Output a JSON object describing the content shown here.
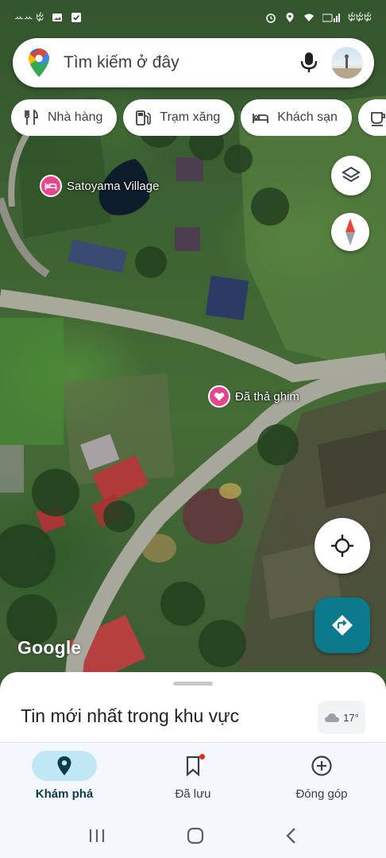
{
  "status_bar": {
    "left_text": "ꕀꕀ ꔲ",
    "right_text": "ꔲꔲꔲ"
  },
  "search": {
    "placeholder": "Tìm kiếm ở đây"
  },
  "chips": [
    {
      "label": "Nhà hàng",
      "icon": "restaurant-icon"
    },
    {
      "label": "Trạm xăng",
      "icon": "gas-station-icon"
    },
    {
      "label": "Khách sạn",
      "icon": "hotel-icon"
    },
    {
      "label": "",
      "icon": "coffee-icon"
    }
  ],
  "map": {
    "places": [
      {
        "label": "Satoyama Village",
        "icon": "hotel-icon",
        "color": "#e8468c"
      },
      {
        "label": "Đã thả ghim",
        "icon": "heart-icon",
        "color": "#e8468c"
      }
    ],
    "attribution": "Google"
  },
  "bottom_sheet": {
    "title": "Tin mới nhất trong khu vực",
    "weather": {
      "temperature": "17°",
      "icon": "cloud-icon"
    }
  },
  "bottom_nav": {
    "items": [
      {
        "label": "Khám phá",
        "icon": "explore-pin-icon",
        "active": true
      },
      {
        "label": "Đã lưu",
        "icon": "bookmark-icon",
        "active": false,
        "badge": true
      },
      {
        "label": "Đóng góp",
        "icon": "add-circle-icon",
        "active": false
      }
    ]
  },
  "colors": {
    "accent": "#0b7a8c",
    "nav_active_bg": "#c2e7f4",
    "pin": "#e8468c"
  }
}
